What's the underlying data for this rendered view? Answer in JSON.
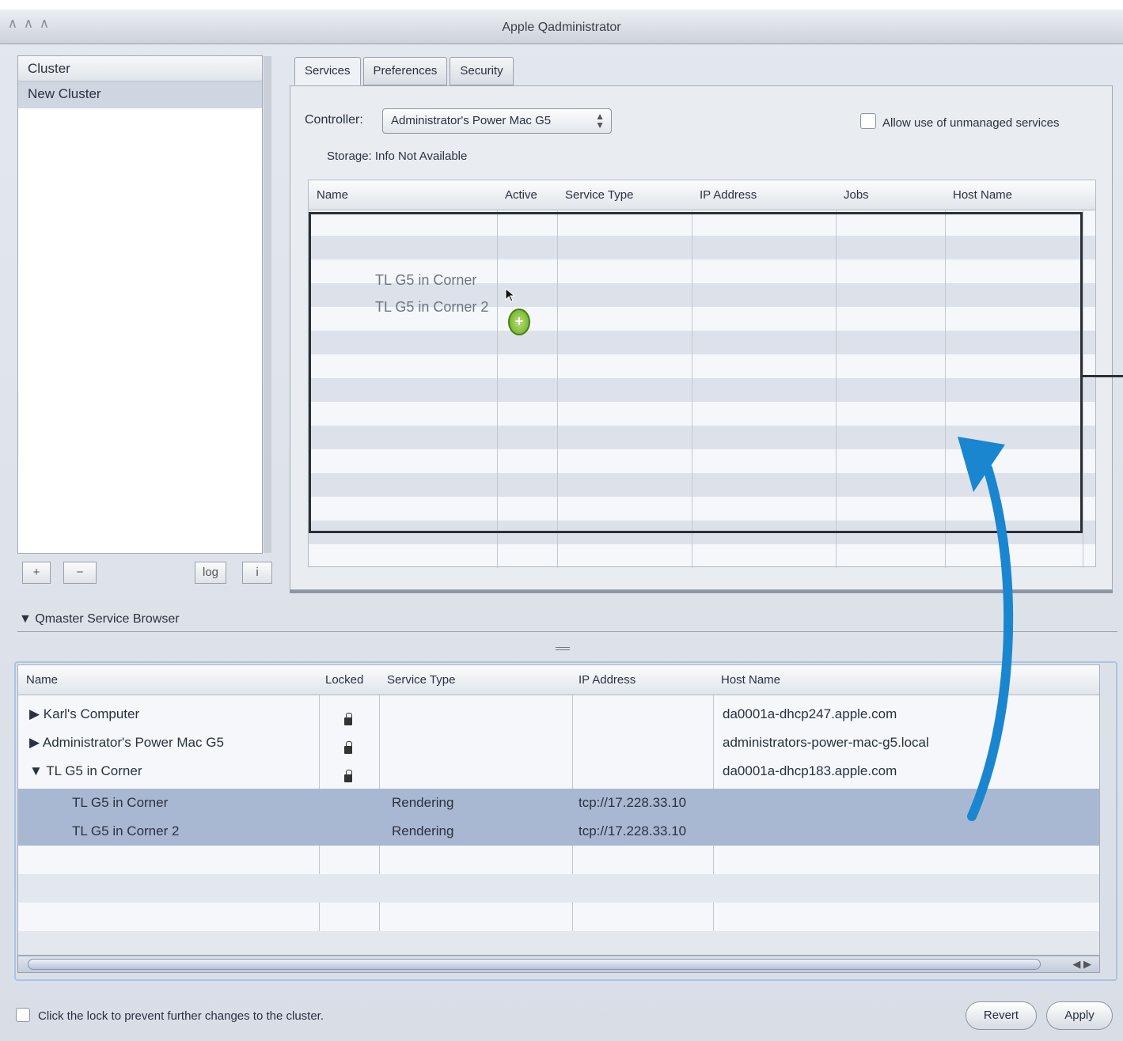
{
  "window": {
    "title": "Apple Qadministrator"
  },
  "sidebar": {
    "header": "Cluster",
    "items": [
      {
        "label": "New Cluster"
      }
    ],
    "buttons": {
      "add": "+",
      "remove": "−",
      "log": "log",
      "info": "i"
    }
  },
  "tabs": [
    {
      "label": "Services",
      "active": true
    },
    {
      "label": "Preferences",
      "active": false
    },
    {
      "label": "Security",
      "active": false
    }
  ],
  "services_panel": {
    "controller_label": "Controller:",
    "controller_value": "Administrator's Power Mac G5",
    "allow_label": "Allow use of unmanaged services",
    "storage_text": "Storage: Info Not Available",
    "columns": [
      "Name",
      "Active",
      "Service Type",
      "IP Address",
      "Jobs",
      "Host Name"
    ],
    "drag_items": [
      "TL G5 in Corner",
      "TL G5 in Corner 2"
    ]
  },
  "browser": {
    "label": "▼ Qmaster Service Browser",
    "columns": [
      "Name",
      "Locked",
      "Service Type",
      "IP Address",
      "Host Name"
    ],
    "rows": [
      {
        "name": "▶ Karl's Computer",
        "locked": true,
        "service_type": "",
        "ip": "",
        "host": "da0001a-dhcp247.apple.com",
        "selected": false
      },
      {
        "name": "▶ Administrator's Power Mac G5",
        "locked": true,
        "service_type": "",
        "ip": "",
        "host": "administrators-power-mac-g5.local",
        "selected": false
      },
      {
        "name": "▼ TL G5 in Corner",
        "locked": true,
        "service_type": "",
        "ip": "",
        "host": "da0001a-dhcp183.apple.com",
        "selected": false
      },
      {
        "name": "TL G5 in Corner",
        "locked": false,
        "service_type": "Rendering",
        "ip": "tcp://17.228.33.10",
        "host": "",
        "selected": true
      },
      {
        "name": "TL G5 in Corner 2",
        "locked": false,
        "service_type": "Rendering",
        "ip": "tcp://17.228.33.10",
        "host": "",
        "selected": true
      }
    ]
  },
  "footer": {
    "lock_text": "Click the lock to prevent further changes to the cluster.",
    "revert": "Revert",
    "apply": "Apply"
  },
  "colors": {
    "selection": "#a9b8d2",
    "arrow": "#1a86d0",
    "drop_border": "#2b2f36"
  }
}
